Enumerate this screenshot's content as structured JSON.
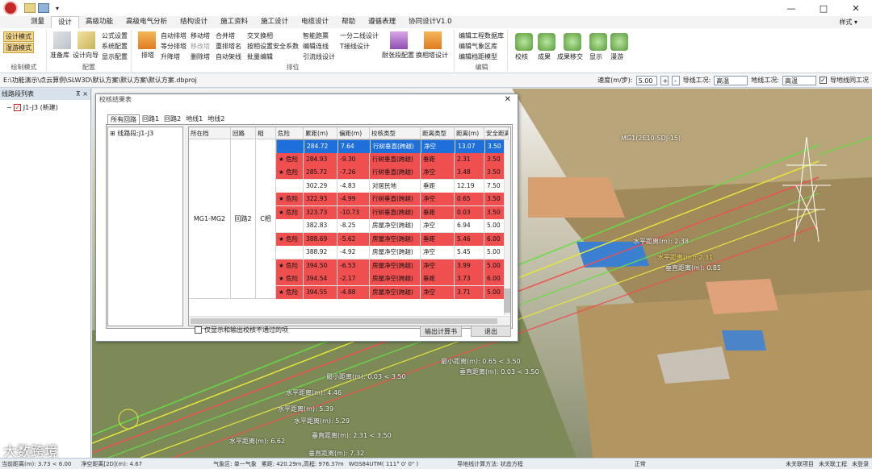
{
  "title_bar": {
    "window_controls": [
      "—",
      "□",
      "✕"
    ]
  },
  "menu": {
    "tabs": [
      "测量",
      "设计",
      "高级功能",
      "高级电气分析",
      "结构设计",
      "施工资料",
      "施工设计",
      "电缆设计",
      "帮助",
      "遵循表理",
      "协同设计V1.0"
    ],
    "active": "设计",
    "style_label": "样式 ▾"
  },
  "ribbon": {
    "modes": [
      "设计模式",
      "湿游模式"
    ],
    "mode_group_label": "绘制模式",
    "config": {
      "items": [
        "准备库",
        "设计向导"
      ],
      "small": [
        "公式设置",
        "系统配置",
        "显示配置"
      ],
      "label": "配置"
    },
    "tower": {
      "big": "排塔",
      "col1": [
        "自动排塔",
        "等分排塔",
        "升降塔"
      ],
      "col2": [
        "移动塔",
        "移改塔",
        "删除塔"
      ],
      "col3": [
        "合并塔",
        "重排塔名",
        "自动架线"
      ],
      "col4": [
        "交叉换相",
        "按相设置安全系数",
        "批量编辑"
      ],
      "col5": [
        "智能跑票",
        "编辑连线",
        "引流线设计"
      ],
      "col6": [
        "一分二线设计",
        "T接线设计"
      ],
      "big2": "耐张段配置",
      "big3": "换相塔设计",
      "label": "排位"
    },
    "edit": {
      "items": [
        "编辑工程数据库",
        "编辑气象区库",
        "编辑档距模型"
      ],
      "label": "编辑"
    },
    "right": [
      "校核",
      "成果",
      "成果移交",
      "显示",
      "漫游"
    ]
  },
  "pathbar": {
    "path": "E:\\功能演示\\点云算例\\SLW3D\\默认方案\\默认方案\\默认方案.dbproj",
    "speed_label": "速度(m/步):",
    "speed_value": "5.00",
    "line_cond_label": "导线工况:",
    "line_cond_value": "高温",
    "ground_label": "地线工况:",
    "ground_value": "高温",
    "check_label": "导地线同工况"
  },
  "left_panel": {
    "title": "线路段列表",
    "pin": "⊼ ×",
    "tree_item": "J1-J3 (新建)"
  },
  "dialog": {
    "title": "校核结果表",
    "tabs": [
      "所有回路",
      "回路1",
      "回路2",
      "地线1",
      "地线2"
    ],
    "tree": "线路段:J1-J3",
    "headers": [
      "所在档",
      "回路",
      "相",
      "危险",
      "累距(m)",
      "偏距(m)",
      "校核类型",
      "距离类型",
      "距离(m)",
      "安全距离"
    ],
    "span": "MG1-MG2",
    "loop": "回路2",
    "phase": "C相",
    "rows": [
      {
        "status": "sel",
        "danger": "",
        "cum": "284.72",
        "off": "7.64",
        "type": "行树垂直(跨越)",
        "dtype": "净空",
        "dist": "13.07",
        "safe": "3.50"
      },
      {
        "status": "red",
        "danger": "★ 危险",
        "cum": "284.93",
        "off": "-9.30",
        "type": "行树垂直(跨越)",
        "dtype": "垂距",
        "dist": "2.31",
        "safe": "3.50"
      },
      {
        "status": "red",
        "danger": "★ 危险",
        "cum": "285.72",
        "off": "-7.26",
        "type": "行树垂直(跨越)",
        "dtype": "净空",
        "dist": "3.48",
        "safe": "3.50"
      },
      {
        "status": "white",
        "danger": "",
        "cum": "302.29",
        "off": "-4.83",
        "type": "对居民地",
        "dtype": "垂距",
        "dist": "12.19",
        "safe": "7.50"
      },
      {
        "status": "red",
        "danger": "★ 危险",
        "cum": "322.93",
        "off": "-4.99",
        "type": "行树垂直(跨越)",
        "dtype": "净空",
        "dist": "0.65",
        "safe": "3.50"
      },
      {
        "status": "red",
        "danger": "★ 危险",
        "cum": "323.73",
        "off": "-10.73",
        "type": "行树垂直(跨越)",
        "dtype": "垂距",
        "dist": "0.03",
        "safe": "3.50"
      },
      {
        "status": "white",
        "danger": "",
        "cum": "382.83",
        "off": "-8.25",
        "type": "房屋净空(跨越)",
        "dtype": "净空",
        "dist": "6.94",
        "safe": "5.00"
      },
      {
        "status": "red",
        "danger": "★ 危险",
        "cum": "388.69",
        "off": "-5.62",
        "type": "房屋净空(跨越)",
        "dtype": "垂距",
        "dist": "5.46",
        "safe": "6.00"
      },
      {
        "status": "white",
        "danger": "",
        "cum": "388.92",
        "off": "-4.92",
        "type": "房屋净空(跨越)",
        "dtype": "净空",
        "dist": "5.45",
        "safe": "5.00"
      },
      {
        "status": "red",
        "danger": "★ 危险",
        "cum": "394.50",
        "off": "-6.53",
        "type": "房屋净空(跨越)",
        "dtype": "净空",
        "dist": "3.99",
        "safe": "5.00"
      },
      {
        "status": "red",
        "danger": "★ 危险",
        "cum": "394.54",
        "off": "-2.17",
        "type": "房屋净空(跨越)",
        "dtype": "垂距",
        "dist": "3.73",
        "safe": "6.00"
      },
      {
        "status": "red",
        "danger": "★ 危险",
        "cum": "394.55",
        "off": "-4.88",
        "type": "房屋净空(跨越)",
        "dtype": "净空",
        "dist": "3.71",
        "safe": "5.00"
      }
    ],
    "checkbox": "仅显示和输出校核不通过的项",
    "btn_export": "输出计算书",
    "btn_exit": "退出"
  },
  "scene_labels": [
    "MG1(2E10-SDJ-15)",
    "水平距离(m): 2.38",
    "水平距离(m): 2.31",
    "垂直距离(m): 0.85",
    "最小距离(m): 0.65 < 3.50",
    "垂直距离(m): 0.03 < 3.50",
    "最小距离(m): 0.03 < 3.50",
    "水平距离(m): 4.46",
    "水平距离(m): 5.39",
    "水平距离(m): 5.29",
    "水平距离(m): 6.62",
    "垂直距离(m): 2.31 < 3.50",
    "垂直距离(m): 7.32"
  ],
  "watermark": "大数跨境",
  "statusbar": {
    "s1": "当前距离(m): 3.73 < 6.00",
    "s2": "净空距离[2D](m): 4.67",
    "s3": "气象区: 单一气象",
    "s4": "累距: 420.29m,高程: 976.37m",
    "s5": "WGS84UTM( 111° 0' 0\" )",
    "s6": "导地线计算方法: 状态方程",
    "s7": "正常",
    "s8": "未关联项目",
    "s9": "未关联工程",
    "s10": "未登录"
  },
  "colors": {
    "danger": "#ef4f4f",
    "selected": "#1e6fd9",
    "accent": "#2b579a"
  }
}
